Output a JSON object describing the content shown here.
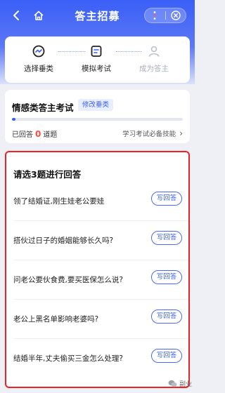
{
  "header": {
    "title": "答主招募"
  },
  "steps": [
    {
      "label": "选择垂类",
      "icon": "activity-circle-icon",
      "state": "done"
    },
    {
      "label": "模拟考试",
      "icon": "document-icon",
      "state": "current"
    },
    {
      "label": "成为答主",
      "icon": "user-icon",
      "state": "pending"
    }
  ],
  "exam": {
    "title": "情感类答主考试",
    "change_label": "修改垂类",
    "answered_prefix": "已回答",
    "answered_count": "0",
    "answered_suffix": "道题",
    "progress_fraction": 0.02,
    "tip": "学习考试必备技能",
    "tip_chevron": "›"
  },
  "questions": {
    "header": "请选3题进行回答",
    "button_label": "写回答",
    "items": [
      {
        "text": "领了结婚证,刚生娃老公要娃"
      },
      {
        "text": "搭伙过日子的婚姻能够长久吗?"
      },
      {
        "text": "问老公要伙食费,要买医保怎么说?"
      },
      {
        "text": "老公上黑名单影响老婆吗?"
      },
      {
        "text": "结婚半年,丈夫偷买三金怎么处理?"
      }
    ]
  },
  "watermark": {
    "text": "副业"
  },
  "colors": {
    "accent": "#3b5ff7",
    "highlight_border": "#ee2222",
    "count_red": "#ff4d3a"
  }
}
